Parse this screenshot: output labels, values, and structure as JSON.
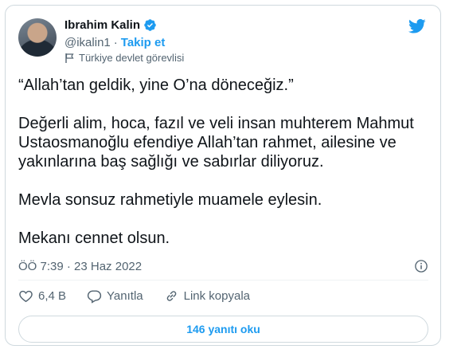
{
  "author": {
    "name": "Ibrahim Kalin",
    "handle": "@ikalin1",
    "separator": "·",
    "follow_label": "Takip et",
    "account_label": "Türkiye devlet görevlisi"
  },
  "tweet": {
    "paragraphs": [
      "“Allah’tan geldik, yine O’na döneceğiz.”",
      "Değerli alim, hoca, fazıl ve veli insan muhterem Mahmut Ustaosmanoğlu efendiye Allah’tan rahmet, ailesine ve yakınlarına baş sağlığı ve sabırlar diliyoruz.",
      "Mevla sonsuz rahmetiyle muamele eylesin.",
      "Mekanı cennet olsun."
    ],
    "timestamp": "ÖÖ 7:39 · 23 Haz 2022"
  },
  "actions": {
    "like_count": "6,4 B",
    "reply_label": "Yanıtla",
    "copy_link_label": "Link kopyala"
  },
  "replies_button_label": "146 yanıtı oku",
  "colors": {
    "accent": "#1d9bf0",
    "text": "#0f1419",
    "muted": "#536471",
    "border": "#cfd9de"
  },
  "icons": [
    "verified-badge-icon",
    "twitter-bird-icon",
    "government-flag-icon",
    "info-icon",
    "heart-icon",
    "reply-bubble-icon",
    "link-icon"
  ]
}
